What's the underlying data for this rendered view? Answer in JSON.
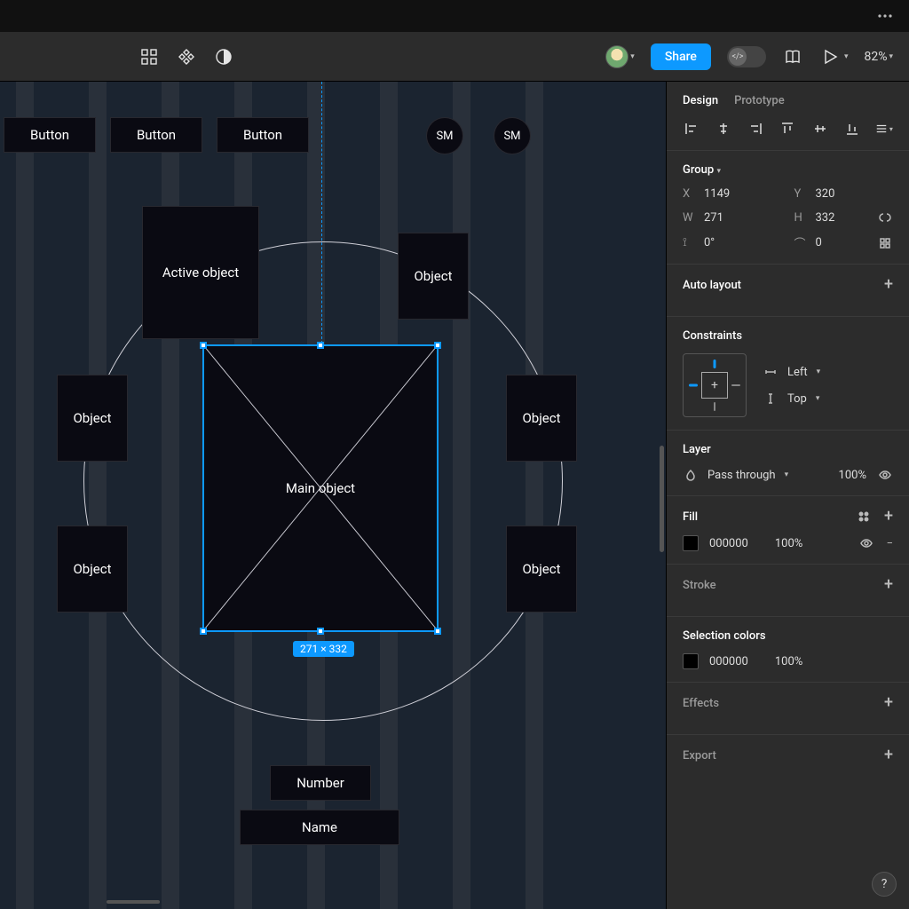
{
  "titlebar": {
    "more_icon": "more-horizontal"
  },
  "toolbar": {
    "share_label": "Share",
    "zoom_label": "82%",
    "book_icon": "book",
    "play_icon": "play",
    "dev_icon": "code"
  },
  "panel": {
    "tabs": {
      "design": "Design",
      "prototype": "Prototype"
    },
    "frame": {
      "title": "Group",
      "x_label": "X",
      "x": "1149",
      "y_label": "Y",
      "y": "320",
      "w_label": "W",
      "w": "271",
      "h_label": "H",
      "h": "332",
      "r_label": "⌐",
      "rotation": "0°",
      "c_label": "⌒",
      "corner": "0"
    },
    "autolayout": {
      "title": "Auto layout"
    },
    "constraints": {
      "title": "Constraints",
      "h": "Left",
      "v": "Top"
    },
    "layer": {
      "title": "Layer",
      "blend": "Pass through",
      "opacity": "100%"
    },
    "fill": {
      "title": "Fill",
      "hex": "000000",
      "opacity": "100%"
    },
    "stroke": {
      "title": "Stroke"
    },
    "selection_colors": {
      "title": "Selection colors",
      "hex": "000000",
      "opacity": "100%"
    },
    "effects": {
      "title": "Effects"
    },
    "export": {
      "title": "Export"
    }
  },
  "canvas": {
    "buttons": [
      "Button",
      "Button",
      "Button"
    ],
    "sm": [
      "SM",
      "SM"
    ],
    "active": "Active object",
    "main": "Main object",
    "obj": "Object",
    "number": "Number",
    "name": "Name",
    "dim_badge": "271 × 332"
  },
  "help": "?"
}
